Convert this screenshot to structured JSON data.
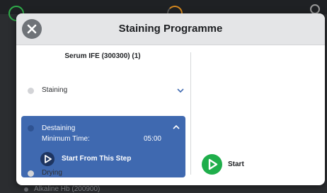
{
  "dialog": {
    "title": "Staining Programme",
    "close_icon": "close-icon"
  },
  "programme": {
    "title": "Serum IFE (300300) (1)"
  },
  "steps": [
    {
      "label": "Staining",
      "expanded": false,
      "icon": "chevron-down-icon"
    },
    {
      "label": "Destaining",
      "expanded": true,
      "icon": "chevron-up-icon",
      "min_time_label": "Minimum Time:",
      "min_time_value": "05:00",
      "start_from_label": "Start From This Step",
      "start_from_icon": "play-icon"
    },
    {
      "label": "Drying",
      "expanded": false,
      "icon": "chevron-down-icon"
    }
  ],
  "actions": {
    "start_label": "Start",
    "start_icon": "play-icon"
  },
  "background": {
    "list_item": "Alkaline Hb (200900)"
  },
  "colors": {
    "active_step": "#3f69b0",
    "start_green": "#1fae4b",
    "header_bg": "#e4e5e7"
  }
}
